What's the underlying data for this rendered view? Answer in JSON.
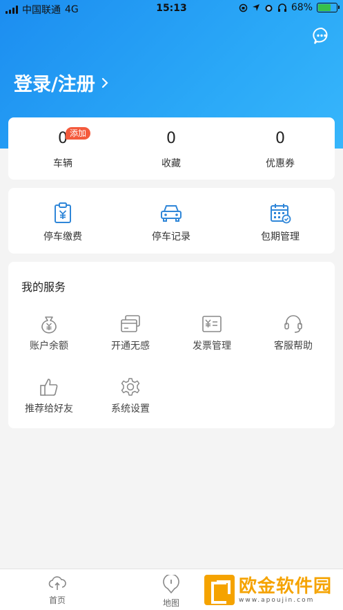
{
  "status_bar": {
    "carrier": "中国联通",
    "network": "4G",
    "time": "15:13",
    "battery": "68%"
  },
  "header": {
    "login_label": "登录/注册",
    "chevron": "chevron-right-icon",
    "message_icon": "chat-bubble-icon"
  },
  "stats": [
    {
      "value": "0",
      "label": "车辆",
      "badge": "添加"
    },
    {
      "value": "0",
      "label": "收藏"
    },
    {
      "value": "0",
      "label": "优惠券"
    }
  ],
  "quick_actions": [
    {
      "label": "停车缴费",
      "icon": "parking-fee-icon"
    },
    {
      "label": "停车记录",
      "icon": "car-icon"
    },
    {
      "label": "包期管理",
      "icon": "calendar-icon"
    }
  ],
  "services": {
    "title": "我的服务",
    "items": [
      {
        "label": "账户余额",
        "icon": "money-bag-icon"
      },
      {
        "label": "开通无感",
        "icon": "card-icon"
      },
      {
        "label": "发票管理",
        "icon": "invoice-icon"
      },
      {
        "label": "客服帮助",
        "icon": "headset-icon"
      },
      {
        "label": "推荐给好友",
        "icon": "thumbs-up-icon"
      },
      {
        "label": "系统设置",
        "icon": "gear-icon"
      }
    ]
  },
  "tabbar": [
    {
      "label": "首页",
      "icon": "home-icon"
    },
    {
      "label": "地图",
      "icon": "map-pin-icon"
    }
  ],
  "watermark": {
    "name": "欧金软件园",
    "url": "www.apoujin.com"
  },
  "colors": {
    "brand_blue": "#1c8df0",
    "icon_blue": "#2f86d8",
    "badge_red": "#f45a3c",
    "watermark_orange": "#f5a300"
  }
}
